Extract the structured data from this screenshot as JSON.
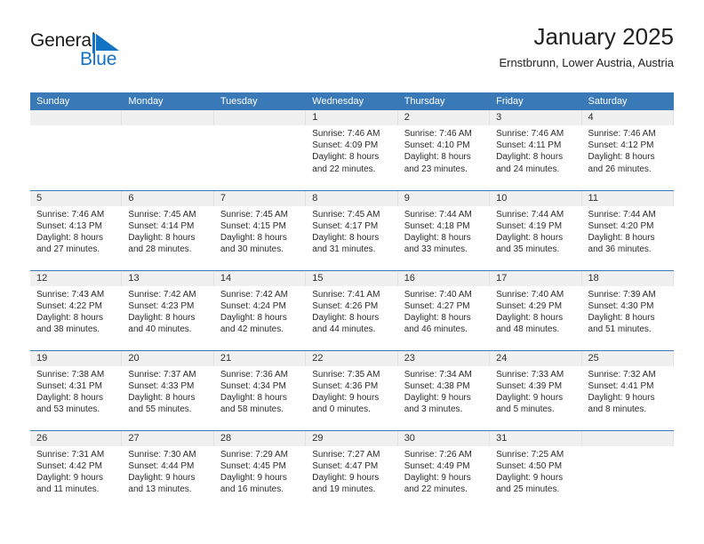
{
  "brand": {
    "name_part1": "General",
    "name_part2": "Blue",
    "flag_icon": "triangle-flag-icon",
    "blue": "#1273c4"
  },
  "header": {
    "title": "January 2025",
    "subtitle": "Ernstbrunn, Lower Austria, Austria"
  },
  "calendar": {
    "header_color": "#3a79b8",
    "weekday_headers": [
      "Sunday",
      "Monday",
      "Tuesday",
      "Wednesday",
      "Thursday",
      "Friday",
      "Saturday"
    ],
    "weeks": [
      [
        {
          "day": "",
          "empty": true
        },
        {
          "day": "",
          "empty": true
        },
        {
          "day": "",
          "empty": true
        },
        {
          "day": "1",
          "sunrise": "Sunrise: 7:46 AM",
          "sunset": "Sunset: 4:09 PM",
          "daylight1": "Daylight: 8 hours",
          "daylight2": "and 22 minutes."
        },
        {
          "day": "2",
          "sunrise": "Sunrise: 7:46 AM",
          "sunset": "Sunset: 4:10 PM",
          "daylight1": "Daylight: 8 hours",
          "daylight2": "and 23 minutes."
        },
        {
          "day": "3",
          "sunrise": "Sunrise: 7:46 AM",
          "sunset": "Sunset: 4:11 PM",
          "daylight1": "Daylight: 8 hours",
          "daylight2": "and 24 minutes."
        },
        {
          "day": "4",
          "sunrise": "Sunrise: 7:46 AM",
          "sunset": "Sunset: 4:12 PM",
          "daylight1": "Daylight: 8 hours",
          "daylight2": "and 26 minutes."
        }
      ],
      [
        {
          "day": "5",
          "sunrise": "Sunrise: 7:46 AM",
          "sunset": "Sunset: 4:13 PM",
          "daylight1": "Daylight: 8 hours",
          "daylight2": "and 27 minutes."
        },
        {
          "day": "6",
          "sunrise": "Sunrise: 7:45 AM",
          "sunset": "Sunset: 4:14 PM",
          "daylight1": "Daylight: 8 hours",
          "daylight2": "and 28 minutes."
        },
        {
          "day": "7",
          "sunrise": "Sunrise: 7:45 AM",
          "sunset": "Sunset: 4:15 PM",
          "daylight1": "Daylight: 8 hours",
          "daylight2": "and 30 minutes."
        },
        {
          "day": "8",
          "sunrise": "Sunrise: 7:45 AM",
          "sunset": "Sunset: 4:17 PM",
          "daylight1": "Daylight: 8 hours",
          "daylight2": "and 31 minutes."
        },
        {
          "day": "9",
          "sunrise": "Sunrise: 7:44 AM",
          "sunset": "Sunset: 4:18 PM",
          "daylight1": "Daylight: 8 hours",
          "daylight2": "and 33 minutes."
        },
        {
          "day": "10",
          "sunrise": "Sunrise: 7:44 AM",
          "sunset": "Sunset: 4:19 PM",
          "daylight1": "Daylight: 8 hours",
          "daylight2": "and 35 minutes."
        },
        {
          "day": "11",
          "sunrise": "Sunrise: 7:44 AM",
          "sunset": "Sunset: 4:20 PM",
          "daylight1": "Daylight: 8 hours",
          "daylight2": "and 36 minutes."
        }
      ],
      [
        {
          "day": "12",
          "sunrise": "Sunrise: 7:43 AM",
          "sunset": "Sunset: 4:22 PM",
          "daylight1": "Daylight: 8 hours",
          "daylight2": "and 38 minutes."
        },
        {
          "day": "13",
          "sunrise": "Sunrise: 7:42 AM",
          "sunset": "Sunset: 4:23 PM",
          "daylight1": "Daylight: 8 hours",
          "daylight2": "and 40 minutes."
        },
        {
          "day": "14",
          "sunrise": "Sunrise: 7:42 AM",
          "sunset": "Sunset: 4:24 PM",
          "daylight1": "Daylight: 8 hours",
          "daylight2": "and 42 minutes."
        },
        {
          "day": "15",
          "sunrise": "Sunrise: 7:41 AM",
          "sunset": "Sunset: 4:26 PM",
          "daylight1": "Daylight: 8 hours",
          "daylight2": "and 44 minutes."
        },
        {
          "day": "16",
          "sunrise": "Sunrise: 7:40 AM",
          "sunset": "Sunset: 4:27 PM",
          "daylight1": "Daylight: 8 hours",
          "daylight2": "and 46 minutes."
        },
        {
          "day": "17",
          "sunrise": "Sunrise: 7:40 AM",
          "sunset": "Sunset: 4:29 PM",
          "daylight1": "Daylight: 8 hours",
          "daylight2": "and 48 minutes."
        },
        {
          "day": "18",
          "sunrise": "Sunrise: 7:39 AM",
          "sunset": "Sunset: 4:30 PM",
          "daylight1": "Daylight: 8 hours",
          "daylight2": "and 51 minutes."
        }
      ],
      [
        {
          "day": "19",
          "sunrise": "Sunrise: 7:38 AM",
          "sunset": "Sunset: 4:31 PM",
          "daylight1": "Daylight: 8 hours",
          "daylight2": "and 53 minutes."
        },
        {
          "day": "20",
          "sunrise": "Sunrise: 7:37 AM",
          "sunset": "Sunset: 4:33 PM",
          "daylight1": "Daylight: 8 hours",
          "daylight2": "and 55 minutes."
        },
        {
          "day": "21",
          "sunrise": "Sunrise: 7:36 AM",
          "sunset": "Sunset: 4:34 PM",
          "daylight1": "Daylight: 8 hours",
          "daylight2": "and 58 minutes."
        },
        {
          "day": "22",
          "sunrise": "Sunrise: 7:35 AM",
          "sunset": "Sunset: 4:36 PM",
          "daylight1": "Daylight: 9 hours",
          "daylight2": "and 0 minutes."
        },
        {
          "day": "23",
          "sunrise": "Sunrise: 7:34 AM",
          "sunset": "Sunset: 4:38 PM",
          "daylight1": "Daylight: 9 hours",
          "daylight2": "and 3 minutes."
        },
        {
          "day": "24",
          "sunrise": "Sunrise: 7:33 AM",
          "sunset": "Sunset: 4:39 PM",
          "daylight1": "Daylight: 9 hours",
          "daylight2": "and 5 minutes."
        },
        {
          "day": "25",
          "sunrise": "Sunrise: 7:32 AM",
          "sunset": "Sunset: 4:41 PM",
          "daylight1": "Daylight: 9 hours",
          "daylight2": "and 8 minutes."
        }
      ],
      [
        {
          "day": "26",
          "sunrise": "Sunrise: 7:31 AM",
          "sunset": "Sunset: 4:42 PM",
          "daylight1": "Daylight: 9 hours",
          "daylight2": "and 11 minutes."
        },
        {
          "day": "27",
          "sunrise": "Sunrise: 7:30 AM",
          "sunset": "Sunset: 4:44 PM",
          "daylight1": "Daylight: 9 hours",
          "daylight2": "and 13 minutes."
        },
        {
          "day": "28",
          "sunrise": "Sunrise: 7:29 AM",
          "sunset": "Sunset: 4:45 PM",
          "daylight1": "Daylight: 9 hours",
          "daylight2": "and 16 minutes."
        },
        {
          "day": "29",
          "sunrise": "Sunrise: 7:27 AM",
          "sunset": "Sunset: 4:47 PM",
          "daylight1": "Daylight: 9 hours",
          "daylight2": "and 19 minutes."
        },
        {
          "day": "30",
          "sunrise": "Sunrise: 7:26 AM",
          "sunset": "Sunset: 4:49 PM",
          "daylight1": "Daylight: 9 hours",
          "daylight2": "and 22 minutes."
        },
        {
          "day": "31",
          "sunrise": "Sunrise: 7:25 AM",
          "sunset": "Sunset: 4:50 PM",
          "daylight1": "Daylight: 9 hours",
          "daylight2": "and 25 minutes."
        },
        {
          "day": "",
          "empty": true
        }
      ]
    ]
  }
}
